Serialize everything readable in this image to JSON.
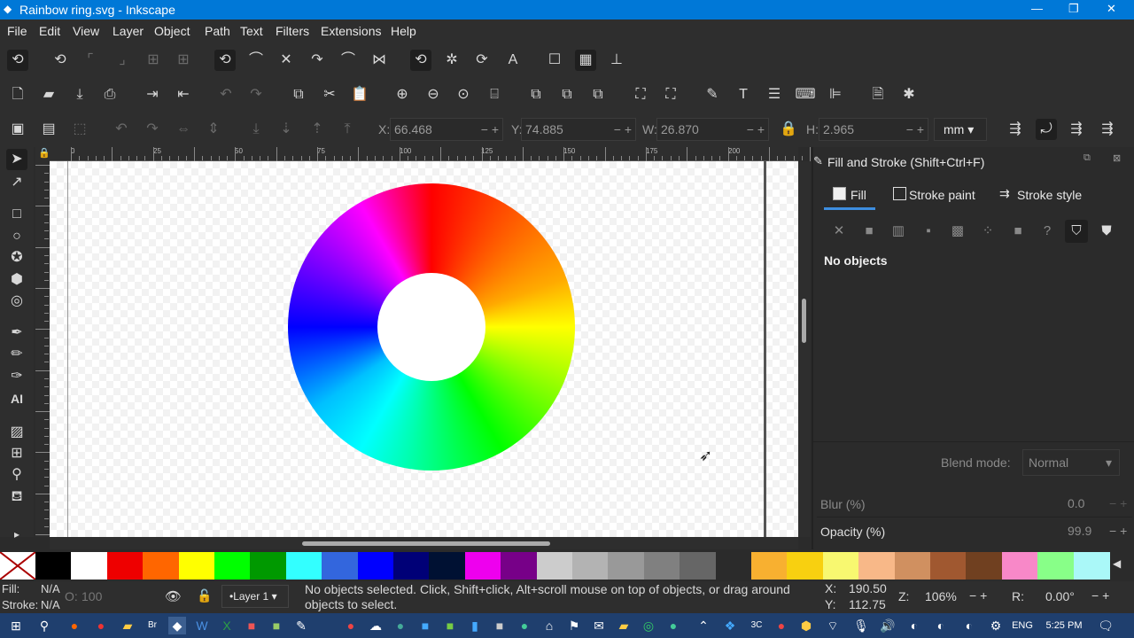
{
  "window": {
    "title": "Rainbow ring.svg - Inkscape",
    "minimize": "—",
    "maximize": "❐",
    "close": "✕"
  },
  "menu": [
    "File",
    "Edit",
    "View",
    "Layer",
    "Object",
    "Path",
    "Text",
    "Filters",
    "Extensions",
    "Help"
  ],
  "controls": {
    "x_label": "X:",
    "x_value": "66.468",
    "y_label": "Y:",
    "y_value": "74.885",
    "w_label": "W:",
    "w_value": "26.870",
    "h_label": "H:",
    "h_value": "2.965",
    "unit": "mm"
  },
  "ruler_labels": [
    "0",
    "25",
    "50",
    "75",
    "100",
    "125",
    "150",
    "175",
    "200"
  ],
  "dock": {
    "title": "Fill and Stroke (Shift+Ctrl+F)",
    "tab_fill": "Fill",
    "tab_stroke_paint": "Stroke paint",
    "tab_stroke_style": "Stroke style",
    "no_objects": "No objects",
    "blend_label": "Blend mode:",
    "blend_value": "Normal",
    "blur_label": "Blur (%)",
    "blur_value": "0.0",
    "opacity_label": "Opacity (%)",
    "opacity_value": "99.9"
  },
  "palette": [
    "#000000",
    "#ffffff",
    "#ee0000",
    "#ff6600",
    "#ffff00",
    "#00ff00",
    "#009900",
    "#33ffff",
    "#3366dd",
    "#0000ff",
    "#000077",
    "#001133",
    "#ee00ee",
    "#770088",
    "#cccccc",
    "#b3b3b3",
    "#999999",
    "#808080",
    "#666666",
    "#2b2b2b",
    "#f8b030",
    "#f8d010",
    "#f8f870",
    "#f8b888",
    "#d09060",
    "#a05830",
    "#704020",
    "#f888c8",
    "#88ff88",
    "#aaf8f8"
  ],
  "status": {
    "fill_label": "Fill:",
    "fill_value": "N/A",
    "stroke_label": "Stroke:",
    "stroke_value": "N/A",
    "o_label": "O:",
    "o_value": "100",
    "layer": "•Layer 1",
    "message": "No objects selected. Click, Shift+click, Alt+scroll mouse on top of objects, or drag around objects to select.",
    "x_label": "X:",
    "x_value": "190.50",
    "y_label": "Y:",
    "y_value": "112.75",
    "z_label": "Z:",
    "zoom": "106%",
    "r_label": "R:",
    "rotation": "0.00°"
  },
  "taskbar": {
    "lang": "ENG",
    "time": "5:25 PM"
  }
}
